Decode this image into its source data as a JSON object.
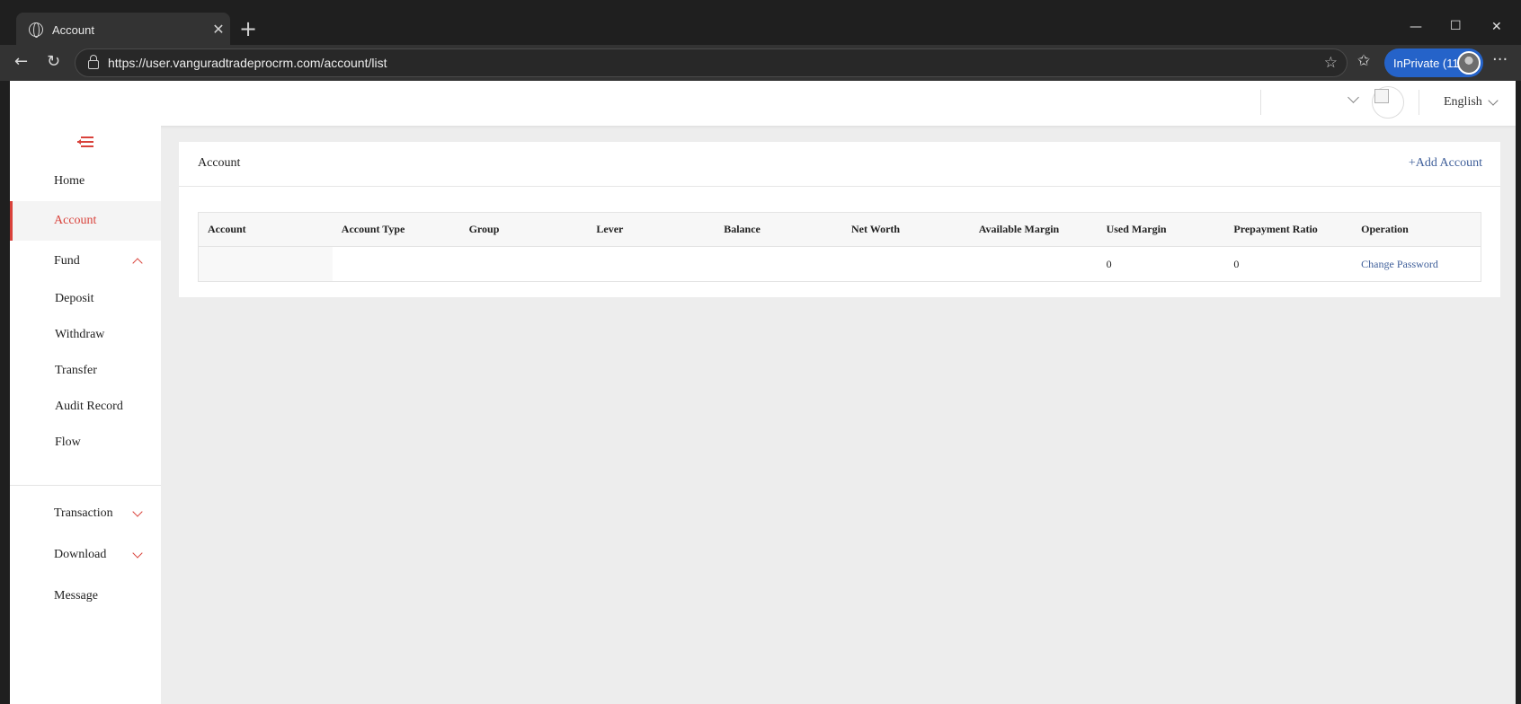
{
  "browser": {
    "tab_title": "Account",
    "url": "https://user.vanguradtradeprocrm.com/account/list",
    "inprivate_label": "InPrivate (11)",
    "icons": [
      "globe-icon",
      "close-icon",
      "plus-icon",
      "back-icon",
      "refresh-icon",
      "lock-icon",
      "star-icon",
      "favorites-icon",
      "more-icon",
      "minimize-icon",
      "maximize-icon",
      "window-close-icon"
    ]
  },
  "header": {
    "language": "English"
  },
  "sidebar": {
    "items": [
      {
        "label": "Home"
      },
      {
        "label": "Account"
      },
      {
        "label": "Fund"
      },
      {
        "label": "Transaction"
      },
      {
        "label": "Download"
      },
      {
        "label": "Message"
      }
    ],
    "fund_sub_items": [
      {
        "label": "Deposit"
      },
      {
        "label": "Withdraw"
      },
      {
        "label": "Transfer"
      },
      {
        "label": "Audit Record"
      },
      {
        "label": "Flow"
      }
    ],
    "accent_color": "#d9423b"
  },
  "main": {
    "card_title": "Account",
    "add_account_label": "+Add Account",
    "table": {
      "columns": [
        "Account",
        "Account Type",
        "Group",
        "Lever",
        "Balance",
        "Net Worth",
        "Available Margin",
        "Used Margin",
        "Prepayment Ratio",
        "Operation"
      ],
      "rows": [
        [
          "",
          "",
          "",
          "",
          "",
          "",
          "",
          "0",
          "0",
          "Change Password"
        ]
      ]
    },
    "link_color": "#3f5f9a"
  }
}
